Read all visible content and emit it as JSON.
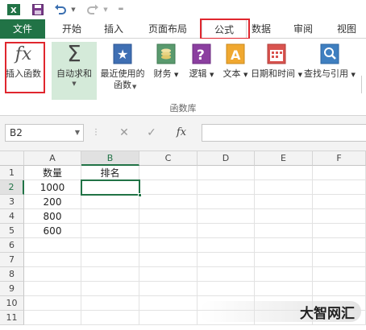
{
  "tabs": {
    "file": "文件",
    "home": "开始",
    "insert": "插入",
    "page_layout": "页面布局",
    "formulas": "公式",
    "data": "数据",
    "review": "审阅",
    "view": "视图"
  },
  "ribbon": {
    "insert_function": "插入函数",
    "autosum": "自动求和",
    "recent": "最近使用的\n函数",
    "financial": "财务",
    "logical": "逻辑",
    "text": "文本",
    "datetime": "日期和时间",
    "lookup": "查找与引用",
    "group_label": "函数库",
    "fx_glyph": "fx"
  },
  "formula_bar": {
    "name_box": "B2",
    "fx_label": "fx"
  },
  "columns": [
    "A",
    "B",
    "C",
    "D",
    "E",
    "F"
  ],
  "rows": [
    "1",
    "2",
    "3",
    "4",
    "5",
    "6",
    "7",
    "8",
    "9",
    "10",
    "11"
  ],
  "cells": {
    "A1": "数量",
    "B1": "排名",
    "A2": "1000",
    "A3": "200",
    "A4": "800",
    "A5": "600"
  },
  "watermark": "大智网汇",
  "colors": {
    "accent": "#217346",
    "highlight": "#e0262e"
  }
}
